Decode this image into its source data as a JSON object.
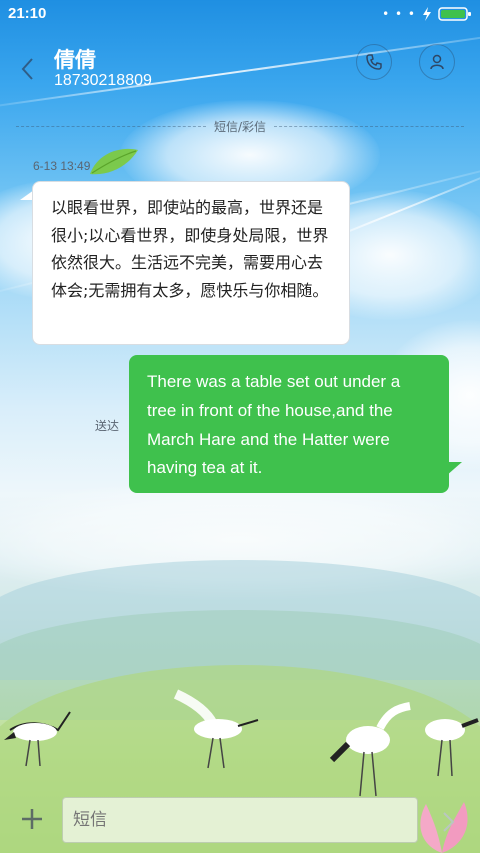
{
  "status_bar": {
    "time": "21:10",
    "icons": [
      "more-dots-icon",
      "charging-bolt-icon",
      "battery-icon"
    ],
    "battery_color": "#3fc14d"
  },
  "header": {
    "contact_name": "倩倩",
    "contact_phone": "18730218809",
    "back_icon": "chevron-left-icon",
    "call_icon": "phone-icon",
    "contact_icon": "person-icon"
  },
  "conversation": {
    "divider_label": "短信/彩信",
    "messages": [
      {
        "direction": "incoming",
        "timestamp": "6-13 13:49",
        "text": "以眼看世界，即使站的最高，世界还是很小;以心看世界，即使身处局限，世界依然很大。生活远不完美，需要用心去体会;无需拥有太多，愿快乐与你相随。",
        "bubble_color": "#ffffff"
      },
      {
        "direction": "outgoing",
        "status": "送达",
        "text": "There was a table set out under a tree in front of the house,and the March Hare and the Hatter were having tea at it.",
        "bubble_color": "#3fc14d"
      }
    ]
  },
  "composer": {
    "placeholder": "短信",
    "value": "",
    "add_icon": "plus-icon",
    "send_icon": "send-arrow-icon"
  }
}
